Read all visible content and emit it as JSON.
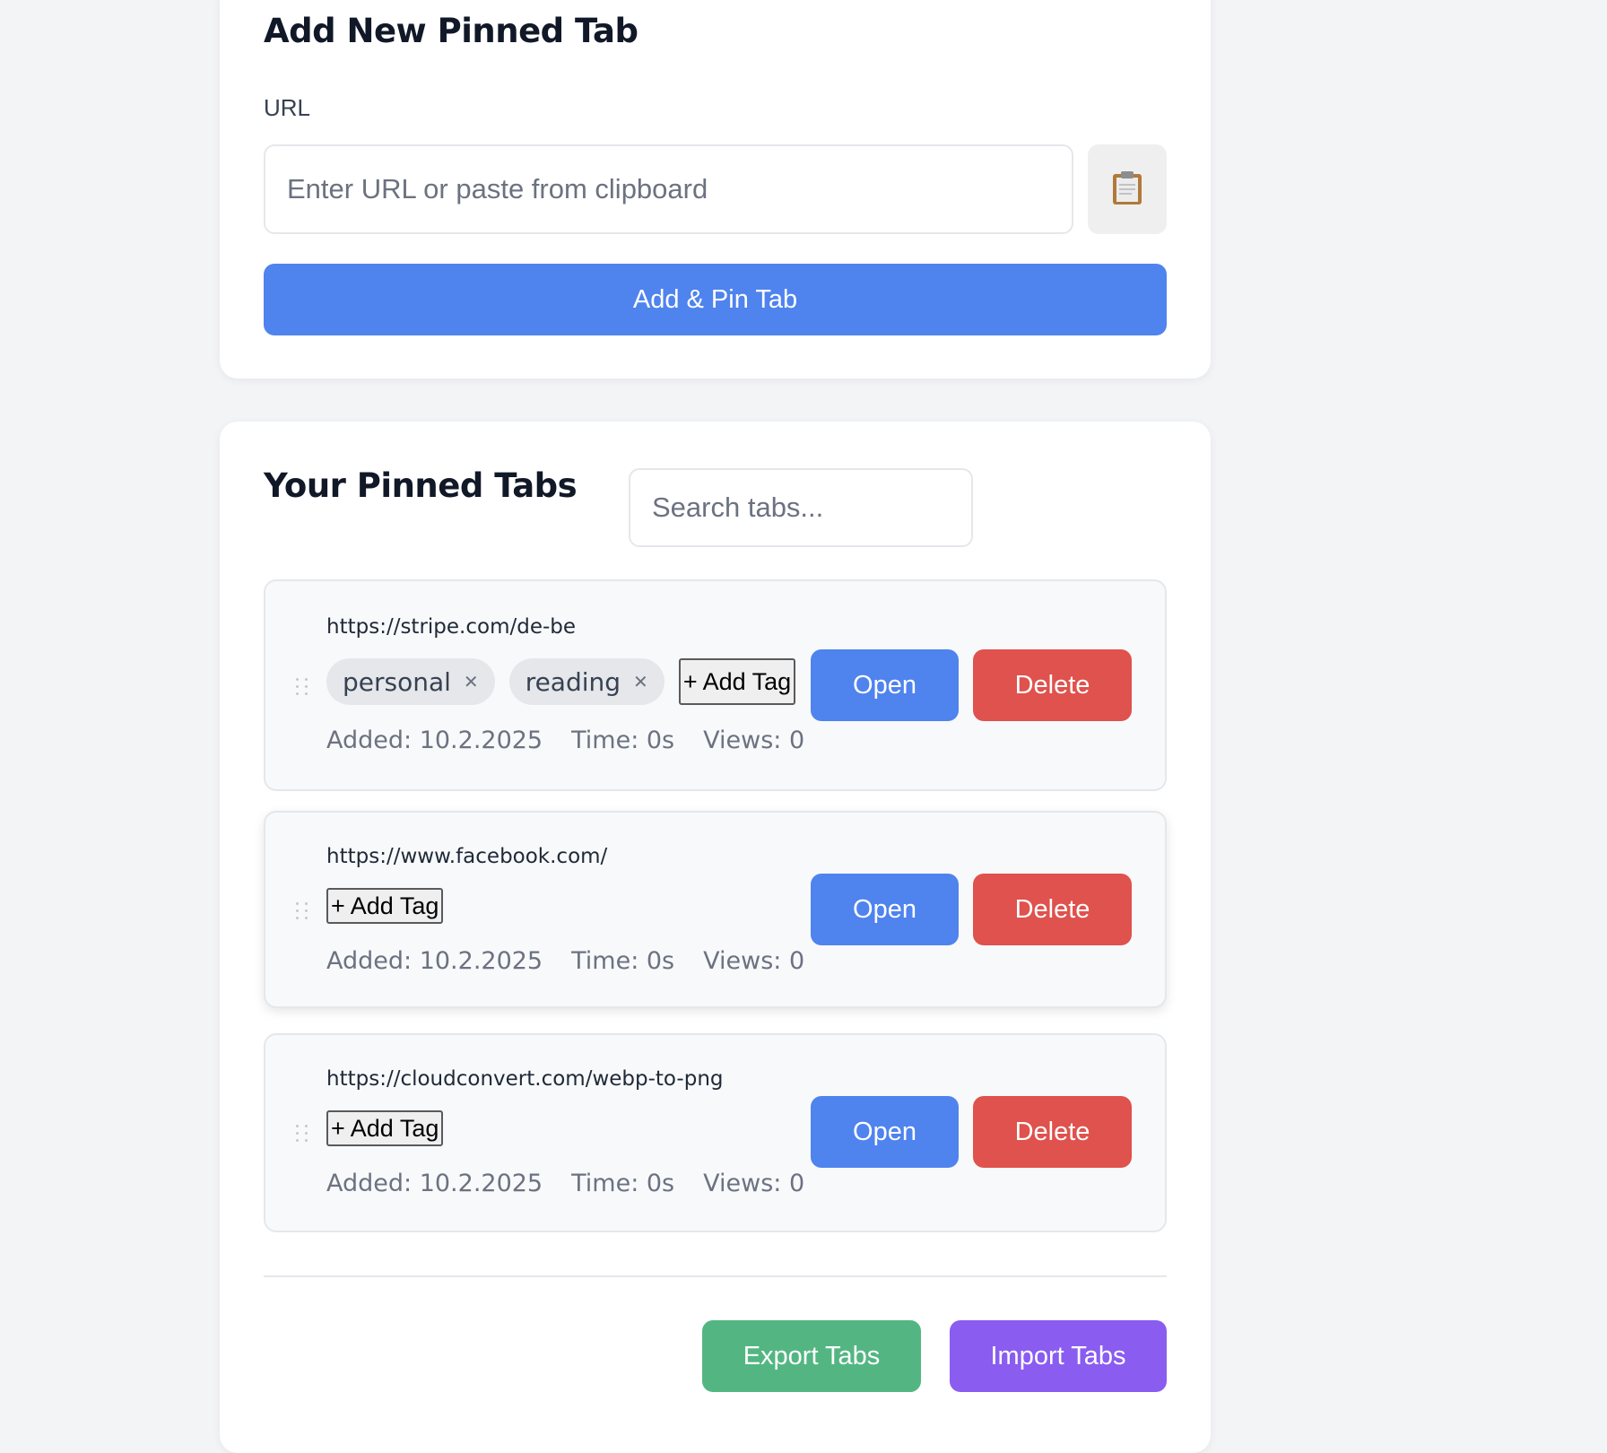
{
  "add_section": {
    "title": "Add New Pinned Tab",
    "url_label": "URL",
    "url_placeholder": "Enter URL or paste from clipboard",
    "url_value": "",
    "paste_icon": "clipboard-icon",
    "add_button": "Add & Pin Tab"
  },
  "list_section": {
    "title": "Your Pinned Tabs",
    "search_placeholder": "Search tabs...",
    "tabs": [
      {
        "url": "https://stripe.com/de-be",
        "tags": [
          "personal",
          "reading"
        ],
        "add_tag": "+ Add Tag",
        "added": "Added: 10.2.2025",
        "time": "Time: 0s",
        "views": "Views: 0",
        "open": "Open",
        "delete": "Delete"
      },
      {
        "url": "https://www.facebook.com/",
        "tags": [],
        "add_tag": "+ Add Tag",
        "added": "Added: 10.2.2025",
        "time": "Time: 0s",
        "views": "Views: 0",
        "open": "Open",
        "delete": "Delete"
      },
      {
        "url": "https://cloudconvert.com/webp-to-png",
        "tags": [],
        "add_tag": "+ Add Tag",
        "added": "Added: 10.2.2025",
        "time": "Time: 0s",
        "views": "Views: 0",
        "open": "Open",
        "delete": "Delete"
      }
    ],
    "export_button": "Export Tabs",
    "import_button": "Import Tabs"
  },
  "colors": {
    "primary": "#4f83ee",
    "danger": "#df524d",
    "success": "#53b682",
    "accent": "#8a5cf0"
  }
}
